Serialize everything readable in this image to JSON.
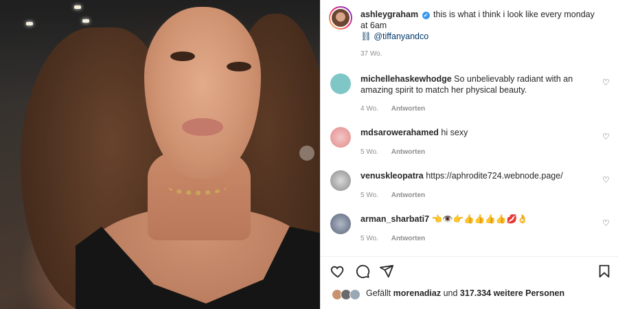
{
  "post": {
    "author": "ashleygraham",
    "caption": "this is what i think i look like every monday at 6am",
    "tag_line": "⛓ @tiffanyandco",
    "time": "37 Wo."
  },
  "comments": [
    {
      "user": "michellehaskewhodge",
      "text": "So unbelievably radiant with an amazing spirit to match her physical beauty.",
      "time": "4 Wo.",
      "reply": "Antworten"
    },
    {
      "user": "mdsarowerahamed",
      "text": "hi sexy",
      "time": "5 Wo.",
      "reply": "Antworten"
    },
    {
      "user": "venuskleopatra",
      "text": "https://aphrodite724.webnode.page/",
      "time": "5 Wo.",
      "reply": "Antworten"
    },
    {
      "user": "arman_sharbati7",
      "text": "👈👁️👉👍👍👍👍💋👌",
      "time": "5 Wo.",
      "reply": "Antworten"
    }
  ],
  "likes": {
    "prefix": "Gefällt",
    "user": "morenadiaz",
    "middle": "und",
    "count": "317.334 weitere Personen"
  },
  "icons": [
    "heart-icon",
    "comment-icon",
    "share-icon",
    "bookmark-icon",
    "verified-icon",
    "like-comment-icon"
  ],
  "colors": {
    "accent": "#3897f0",
    "mention": "#00376b",
    "muted": "#8e8e8e"
  }
}
